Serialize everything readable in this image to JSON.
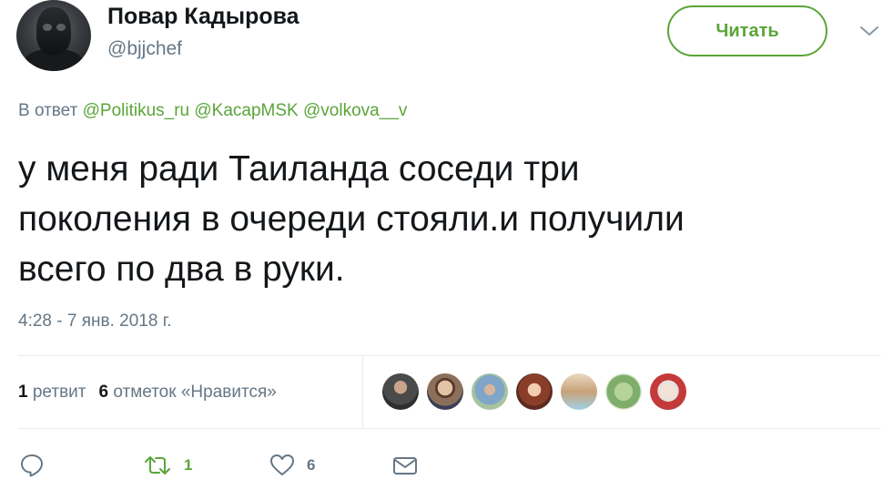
{
  "tweet": {
    "author": {
      "display_name": "Повар Кадырова",
      "handle": "@bjjchef",
      "avatar_icon": "user-avatar"
    },
    "follow_button_label": "Читать",
    "more_icon": "chevron-down-icon",
    "reply_prefix": "В ответ",
    "reply_mentions": [
      "@Politikus_ru",
      "@KacapMSK",
      "@volkova__v"
    ],
    "text_lines": [
      "у меня ради Таиланда соседи три",
      "поколения в очереди стояли.и получили",
      "всего по два в руки."
    ],
    "timestamp": "4:28 - 7 янв. 2018 г.",
    "stats": {
      "retweets_count": "1",
      "retweets_label": "ретвит",
      "likes_count": "6",
      "likes_label": "отметок «Нравится»"
    },
    "likers_count": 7,
    "actions": {
      "reply_icon": "reply-icon",
      "retweet_icon": "retweet-icon",
      "retweet_count": "1",
      "like_icon": "heart-icon",
      "like_count": "6",
      "dm_icon": "envelope-icon"
    },
    "colors": {
      "accent": "#5aa539",
      "secondary_text": "#657786",
      "primary_text": "#14171a",
      "divider": "#e6ecf0"
    }
  }
}
